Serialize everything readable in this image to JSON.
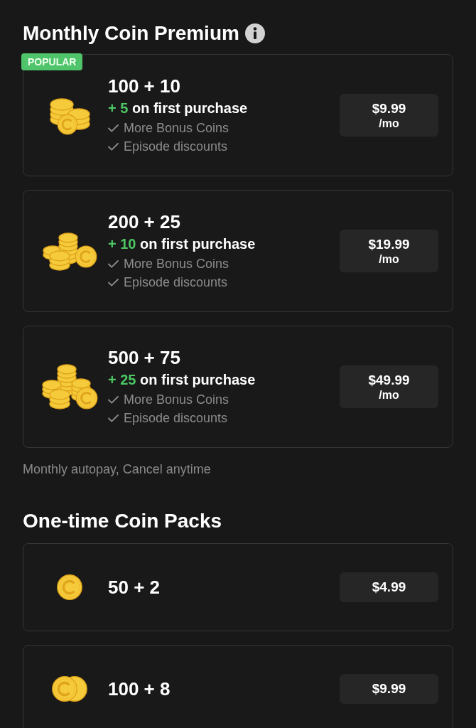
{
  "monthly": {
    "title": "Monthly Coin Premium",
    "plans": [
      {
        "badge": "POPULAR",
        "coins": "100 + 10",
        "bonus": "+ 5",
        "bonus_note": "on first purchase",
        "features": [
          "More Bonus Coins",
          "Episode discounts"
        ],
        "price": "$9.99",
        "period": "/mo"
      },
      {
        "coins": "200 + 25",
        "bonus": "+ 10",
        "bonus_note": "on first purchase",
        "features": [
          "More Bonus Coins",
          "Episode discounts"
        ],
        "price": "$19.99",
        "period": "/mo"
      },
      {
        "coins": "500 + 75",
        "bonus": "+ 25",
        "bonus_note": "on first purchase",
        "features": [
          "More Bonus Coins",
          "Episode discounts"
        ],
        "price": "$49.99",
        "period": "/mo"
      }
    ],
    "note": "Monthly autopay, Cancel anytime"
  },
  "one_time": {
    "title": "One-time Coin Packs",
    "packs": [
      {
        "coins": "50 + 2",
        "price": "$4.99"
      },
      {
        "coins": "100 + 8",
        "price": "$9.99"
      }
    ]
  }
}
